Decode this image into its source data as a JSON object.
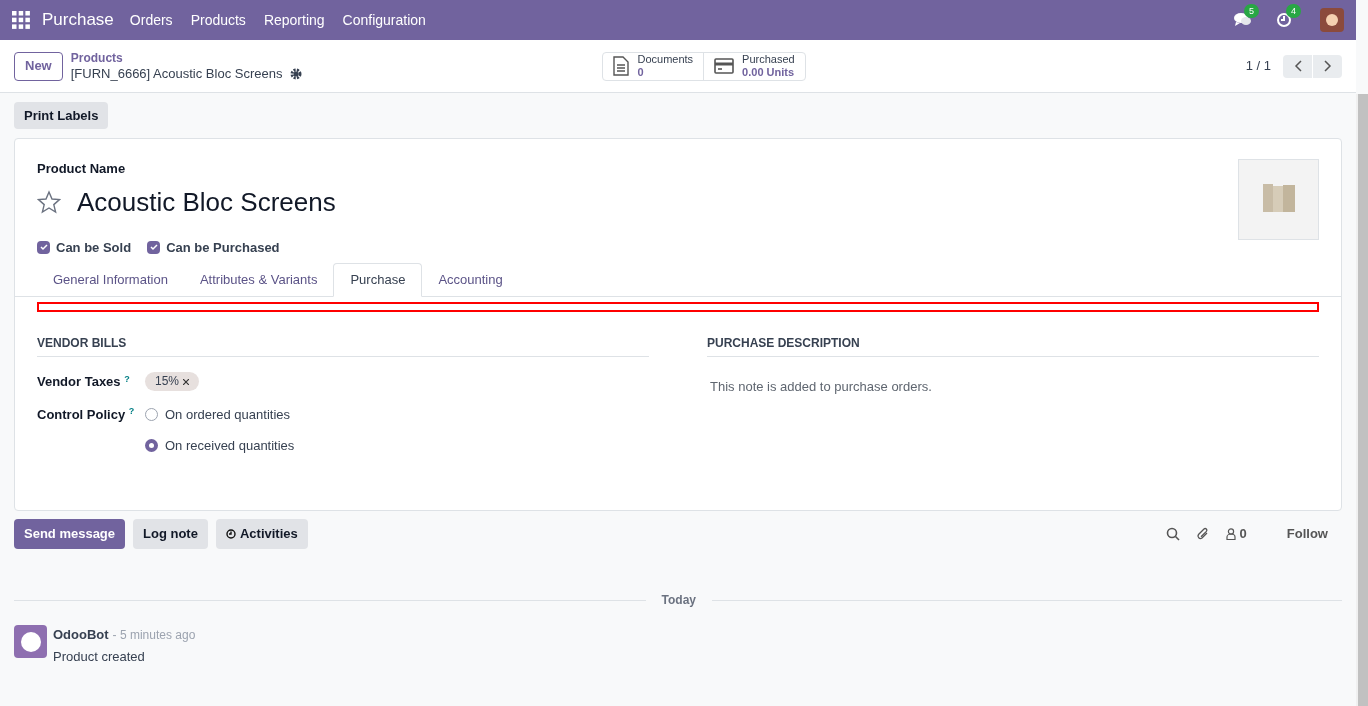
{
  "navbar": {
    "app": "Purchase",
    "menu": [
      "Orders",
      "Products",
      "Reporting",
      "Configuration"
    ],
    "messages_count": "5",
    "activities_count": "4"
  },
  "control_panel": {
    "new_button": "New",
    "breadcrumb": "Products",
    "record": "[FURN_6666] Acoustic Bloc Screens",
    "smart_buttons": [
      {
        "kind": "documents",
        "label": "Documents",
        "value": "0"
      },
      {
        "kind": "purchased",
        "label": "Purchased",
        "value": "0.00 Units"
      }
    ],
    "pager": "1 / 1"
  },
  "actions": [
    "Print Labels"
  ],
  "form": {
    "name_label": "Product Name",
    "name": "Acoustic Bloc Screens",
    "favorite": false,
    "options": [
      {
        "label": "Can be Sold",
        "checked": true
      },
      {
        "label": "Can be Purchased",
        "checked": true
      }
    ],
    "tabs": [
      {
        "label": "General Information",
        "selected": false
      },
      {
        "label": "Attributes & Variants",
        "selected": false
      },
      {
        "label": "Purchase",
        "selected": true
      },
      {
        "label": "Accounting",
        "selected": false
      }
    ],
    "vendor_bills": {
      "title": "VENDOR BILLS",
      "taxes_label": "Vendor Taxes",
      "help_mark": "?",
      "tax_tag": "15%",
      "policy_label": "Control Policy",
      "policy_help": "?",
      "policies": [
        {
          "label": "On ordered quantities",
          "selected": false
        },
        {
          "label": "On received quantities",
          "selected": true
        }
      ]
    },
    "purchase_description": {
      "title": "PURCHASE DESCRIPTION",
      "placeholder": "This note is added to purchase orders."
    }
  },
  "chatter": {
    "buttons": [
      {
        "kind": "primary",
        "label": "Send message"
      },
      {
        "kind": "secondary",
        "label": "Log note"
      },
      {
        "kind": "activities",
        "label": "Activities"
      }
    ],
    "followers": "0",
    "follow": "Follow",
    "date": "Today",
    "messages": [
      {
        "author": "OdooBot",
        "time": "- 5 minutes ago",
        "body": "Product created"
      }
    ]
  }
}
